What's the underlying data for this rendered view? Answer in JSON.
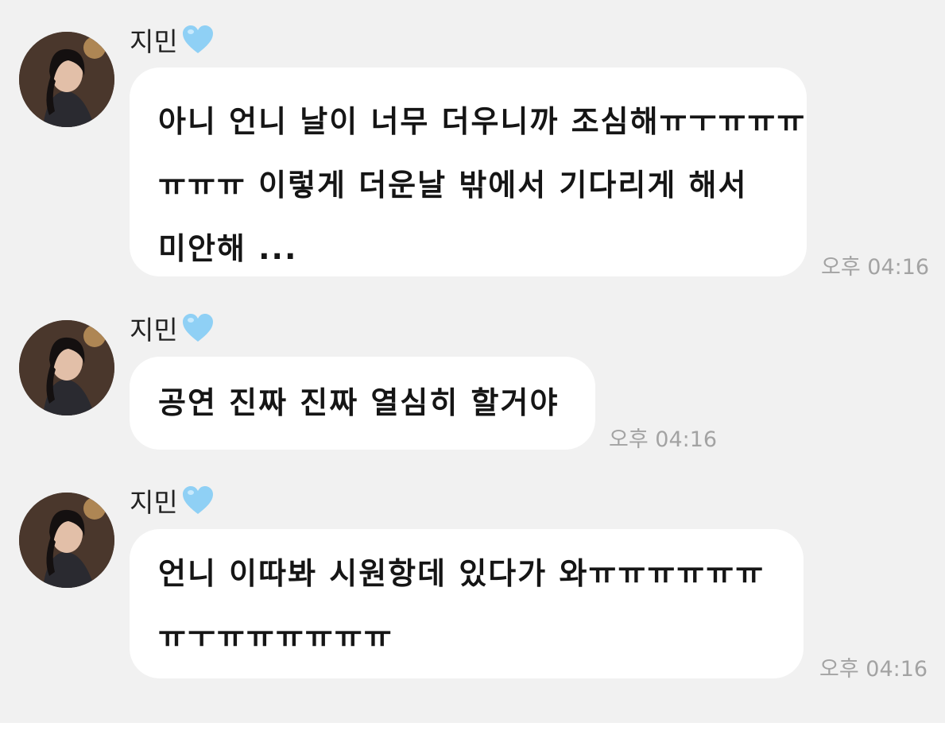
{
  "messages": [
    {
      "sender": "지민",
      "lines": [
        "아니 언니 날이 너무 더우니까 조심해ㅠㅜㅠㅠㅠ",
        "ㅠㅠㅠ 이렇게 더운날 밖에서 기다리게 해서",
        "미안해 ..."
      ],
      "time": "오후 04:16"
    },
    {
      "sender": "지민",
      "lines": [
        "공연 진짜 진짜 열심히 할거야"
      ],
      "time": "오후 04:16"
    },
    {
      "sender": "지민",
      "lines": [
        "언니 이따봐 시원항데 있다가 와ㅠㅠㅠㅠㅠㅠ",
        "ㅠㅜㅠㅠㅠㅠㅠㅠ"
      ],
      "time": "오후 04:16"
    }
  ],
  "icons": {
    "avatar": "profile-photo",
    "heart": "light-blue-heart-emoji"
  },
  "colors": {
    "background": "#f1f1f1",
    "bubble": "#ffffff",
    "heart": "#8fd0f5",
    "time": "#a3a3a3"
  }
}
